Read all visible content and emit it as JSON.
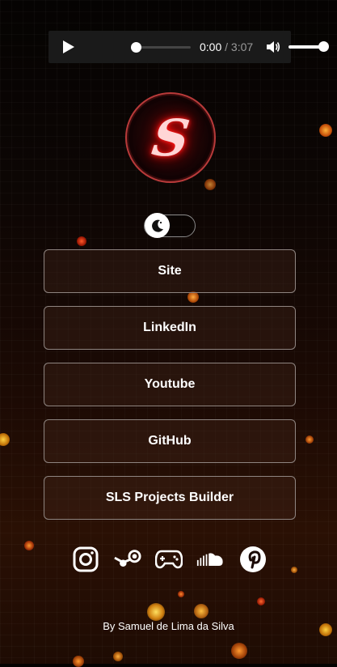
{
  "audio": {
    "current_time": "0:00",
    "separator": " / ",
    "duration": "3:07",
    "progress": 0,
    "volume": 1.0
  },
  "logo": {
    "letter": "S"
  },
  "theme_toggle": {
    "icon": "moon-icon",
    "state": "off"
  },
  "links": [
    {
      "label": "Site"
    },
    {
      "label": "LinkedIn"
    },
    {
      "label": "Youtube"
    },
    {
      "label": "GitHub"
    },
    {
      "label": "SLS Projects Builder"
    }
  ],
  "social": [
    "instagram-icon",
    "steam-icon",
    "gamepad-icon",
    "soundcloud-icon",
    "pinterest-icon"
  ],
  "footer": {
    "text": "By Samuel de Lima da Silva"
  }
}
